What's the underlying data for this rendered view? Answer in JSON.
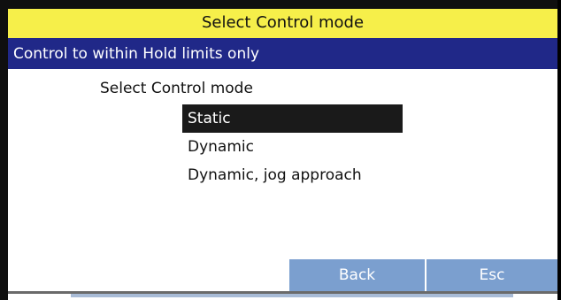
{
  "window": {
    "title": "Select Control mode",
    "status": "Control to within Hold limits only"
  },
  "dialog": {
    "prompt": "Select Control mode",
    "options": [
      {
        "label": "Static",
        "selected": true
      },
      {
        "label": "Dynamic",
        "selected": false
      },
      {
        "label": "Dynamic, jog approach",
        "selected": false
      }
    ]
  },
  "softkeys": {
    "back_label": "Back",
    "esc_label": "Esc"
  },
  "colors": {
    "title_bar": "#f6ef4a",
    "status_bar": "#202888",
    "selection": "#1a1a1a",
    "softkey": "#7b9fcf"
  }
}
